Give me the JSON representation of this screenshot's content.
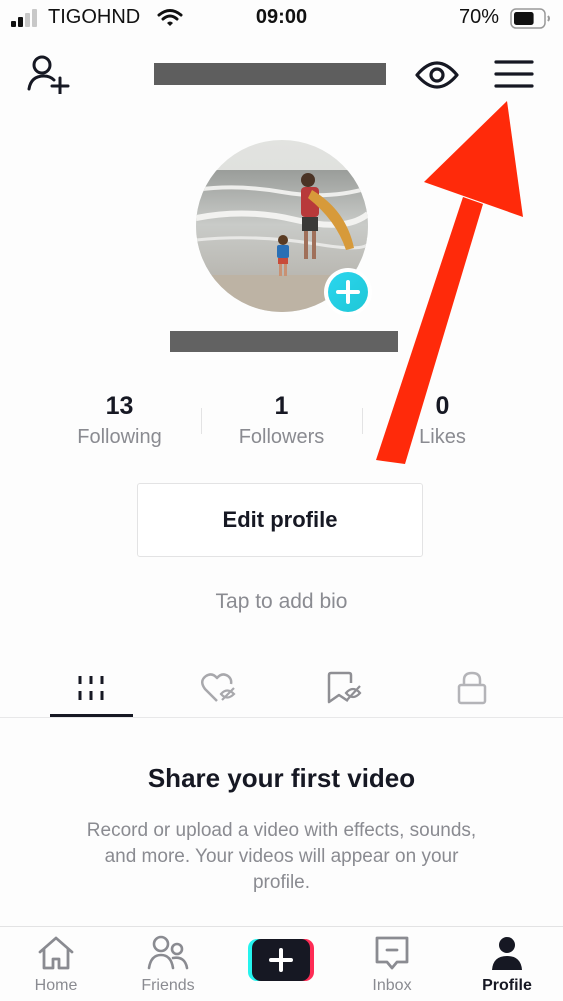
{
  "status_bar": {
    "carrier": "TIGOHND",
    "time": "09:00",
    "battery_percent": "70%",
    "battery_level": 0.7,
    "signal_bars_filled": 2,
    "signal_bars_total": 4
  },
  "header": {
    "username": "[redacted]",
    "icons": [
      "add-friend-icon",
      "eye-icon",
      "menu-icon"
    ]
  },
  "profile": {
    "display_name": "[redacted]",
    "avatar_alt": "Beach photo with adult holding surfboard and child",
    "add_photo_icon": "plus-icon",
    "accent_color": "#20d5ec"
  },
  "stats": [
    {
      "value": "13",
      "label": "Following"
    },
    {
      "value": "1",
      "label": "Followers"
    },
    {
      "value": "0",
      "label": "Likes"
    }
  ],
  "edit_profile_label": "Edit profile",
  "bio_prompt": "Tap to add bio",
  "tabs": [
    {
      "name": "videos",
      "icon": "grid-icon",
      "active": true
    },
    {
      "name": "liked",
      "icon": "heart-hidden-icon",
      "active": false
    },
    {
      "name": "favorites",
      "icon": "bookmark-hidden-icon",
      "active": false
    },
    {
      "name": "private",
      "icon": "lock-icon",
      "active": false
    }
  ],
  "empty_state": {
    "title": "Share your first video",
    "description": "Record or upload a video with effects, sounds, and more. Your videos will appear on your profile."
  },
  "bottom_nav": [
    {
      "label": "Home",
      "icon": "home-icon",
      "active": false
    },
    {
      "label": "Friends",
      "icon": "friends-icon",
      "active": false
    },
    {
      "label": "",
      "icon": "create-plus-icon",
      "active": false
    },
    {
      "label": "Inbox",
      "icon": "inbox-icon",
      "active": false
    },
    {
      "label": "Profile",
      "icon": "profile-icon",
      "active": true
    }
  ],
  "annotation": {
    "type": "arrow",
    "color": "#ff2a0a",
    "points_to": "menu-button"
  }
}
